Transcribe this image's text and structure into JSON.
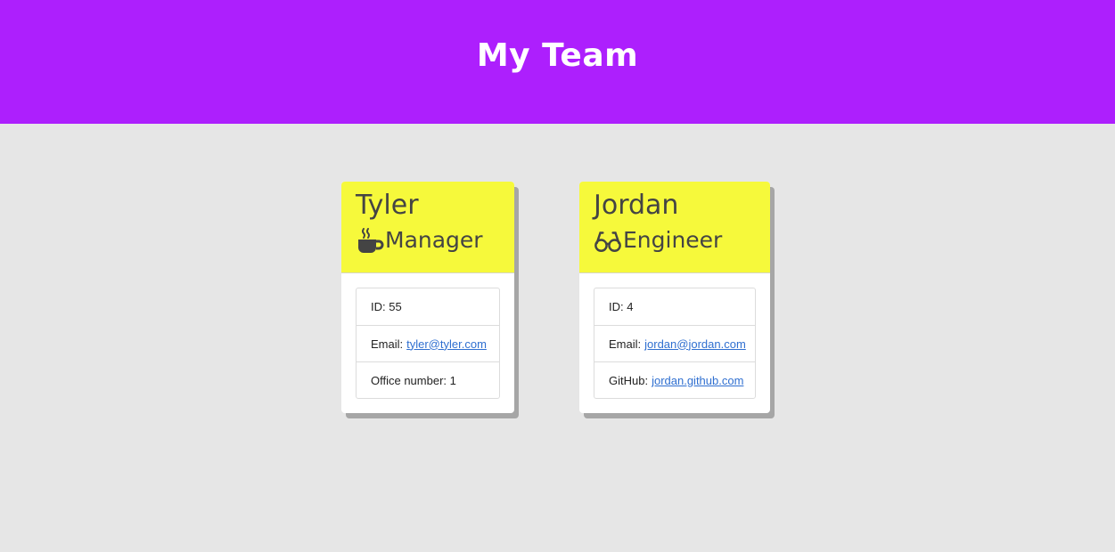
{
  "header": {
    "title": "My Team"
  },
  "colors": {
    "header_bg": "#ad1ffd",
    "card_head_bg": "#f6f93b",
    "page_bg": "#e6e6e6",
    "link": "#2f6fd0"
  },
  "cards": [
    {
      "name": "Tyler",
      "role": "Manager",
      "role_icon": "coffee-mug-icon",
      "id_text": "ID: 55",
      "email_label": "Email:",
      "email": "tyler@tyler.com",
      "extra_label": "Office number:",
      "extra_value": "1"
    },
    {
      "name": "Jordan",
      "role": "Engineer",
      "role_icon": "glasses-icon",
      "id_text": "ID: 4",
      "email_label": "Email:",
      "email": "jordan@jordan.com",
      "extra_label": "GitHub:",
      "extra_value": "jordan.github.com"
    }
  ]
}
